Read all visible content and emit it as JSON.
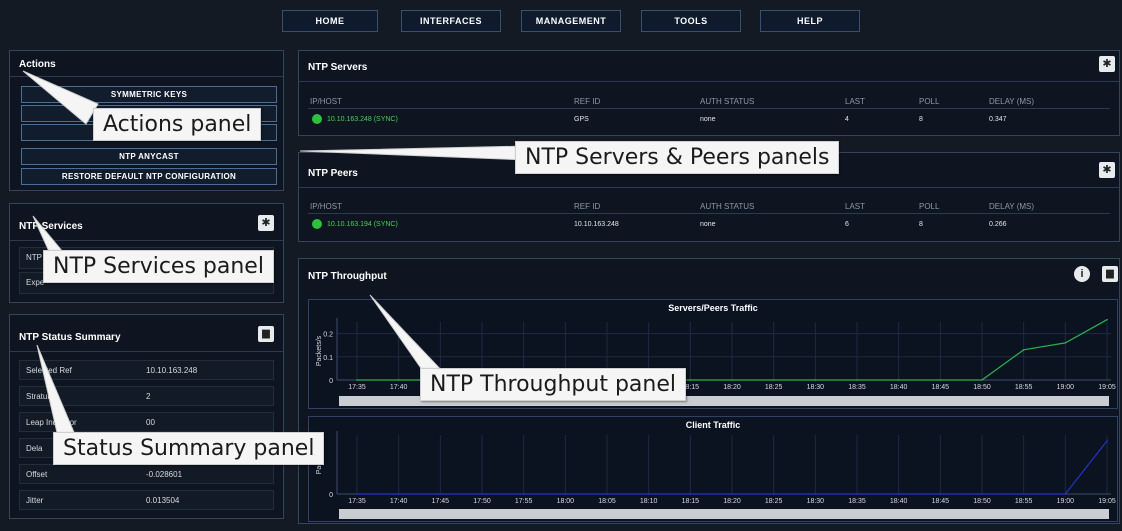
{
  "nav": {
    "items": [
      "HOME",
      "INTERFACES",
      "MANAGEMENT",
      "TOOLS",
      "HELP"
    ]
  },
  "actions": {
    "title": "Actions",
    "buttons": [
      "SYMMETRIC KEYS",
      "",
      "",
      "NTP ANYCAST",
      "RESTORE DEFAULT NTP CONFIGURATION"
    ]
  },
  "services": {
    "title": "NTP Services",
    "rows": [
      "NTP",
      "Expe"
    ]
  },
  "status": {
    "title": "NTP Status Summary",
    "rows": [
      {
        "label": "Selected Ref",
        "value": "10.10.163.248"
      },
      {
        "label": "Stratum",
        "value": "2"
      },
      {
        "label": "Leap Indicator",
        "value": "00"
      },
      {
        "label": "Dela",
        "value": ""
      },
      {
        "label": "Offset",
        "value": "-0.028601"
      },
      {
        "label": "Jitter",
        "value": "0.013504"
      }
    ]
  },
  "table_headers": [
    "IP/HOST",
    "REF ID",
    "AUTH STATUS",
    "LAST",
    "POLL",
    "DELAY (MS)"
  ],
  "servers": {
    "title": "NTP Servers",
    "row": {
      "ip": "10.10.163.248 (SYNC)",
      "ref": "GPS",
      "auth": "none",
      "last": "4",
      "poll": "8",
      "delay": "0.347"
    }
  },
  "peers": {
    "title": "NTP Peers",
    "row": {
      "ip": "10.10.163.194 (SYNC)",
      "ref": "10.10.163.248",
      "auth": "none",
      "last": "6",
      "poll": "8",
      "delay": "0.266"
    }
  },
  "throughput": {
    "title": "NTP Throughput"
  },
  "chart_data": [
    {
      "type": "line",
      "title": "Servers/Peers Traffic",
      "ylabel": "Packets/s",
      "x": [
        "17:35",
        "17:40",
        "17:45",
        "17:50",
        "17:55",
        "18:00",
        "18:05",
        "18:10",
        "18:15",
        "18:20",
        "18:25",
        "18:30",
        "18:35",
        "18:40",
        "18:45",
        "18:50",
        "18:55",
        "19:00",
        "19:05"
      ],
      "yticks": [
        "0",
        "0.1",
        "0.2"
      ],
      "ylim": [
        0,
        0.25
      ],
      "series": [
        {
          "color": "#2bb24c",
          "values": [
            0,
            0,
            0,
            0,
            0,
            0,
            0,
            0,
            0,
            0,
            0,
            0,
            0,
            0,
            0,
            0,
            0.13,
            0.16,
            0.26
          ]
        }
      ]
    },
    {
      "type": "line",
      "title": "Client Traffic",
      "ylabel": "Packe",
      "x": [
        "17:35",
        "17:40",
        "17:45",
        "17:50",
        "17:55",
        "18:00",
        "18:05",
        "18:10",
        "18:15",
        "18:20",
        "18:25",
        "18:30",
        "18:35",
        "18:40",
        "18:45",
        "18:50",
        "18:55",
        "19:00",
        "19:05"
      ],
      "yticks": [
        "0"
      ],
      "ylim": [
        0,
        1
      ],
      "series": [
        {
          "color": "#2333c8",
          "values": [
            0,
            0,
            0,
            0,
            0,
            0,
            0,
            0,
            0,
            0,
            0,
            0,
            0,
            0,
            0,
            0,
            0,
            0,
            0.9
          ]
        }
      ]
    }
  ],
  "callouts": {
    "actions": "Actions panel",
    "servers_peers": "NTP Servers & Peers panels",
    "services": "NTP Services panel",
    "throughput": "NTP Throughput panel",
    "status": "Status Summary panel"
  }
}
